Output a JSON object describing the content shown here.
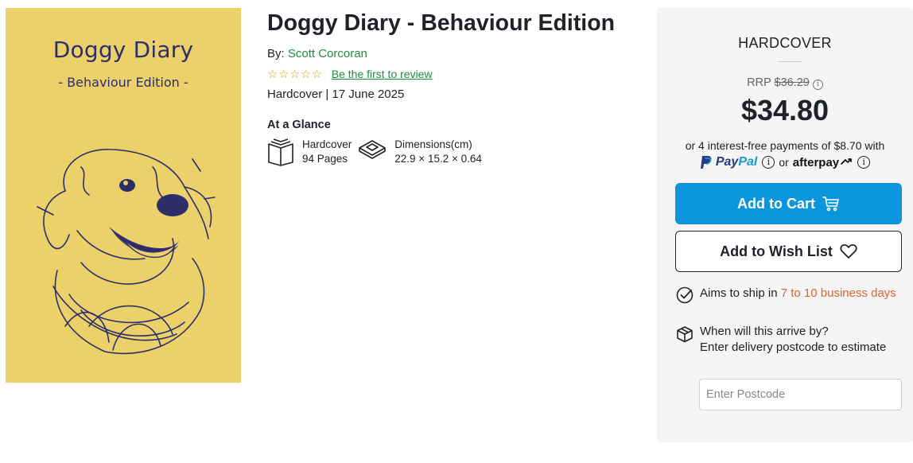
{
  "cover": {
    "title": "Doggy Diary",
    "subtitle": "- Behaviour Edition -"
  },
  "product": {
    "title": "Doggy Diary - Behaviour Edition",
    "by_label": "By:",
    "author": "Scott Corcoran",
    "stars": "☆☆☆☆☆",
    "review_link": "Be the first to review",
    "format_date": "Hardcover | 17 June 2025"
  },
  "glance": {
    "heading": "At a Glance",
    "items": [
      {
        "line1": "Hardcover",
        "line2": "94 Pages",
        "icon": "book-icon"
      },
      {
        "line1": "Dimensions(cm)",
        "line2": "22.9 × 15.2 × 0.64",
        "icon": "dimensions-icon"
      }
    ]
  },
  "purchase": {
    "format": "HARDCOVER",
    "rrp_label": "RRP",
    "rrp_value": "$36.29",
    "rrp_info": "i",
    "price": "$34.80",
    "installments": "or 4 interest-free payments of $8.70 with",
    "paypal_a": "Pay",
    "paypal_b": "Pal",
    "or_text": "or",
    "afterpay": "afterpay",
    "info_glyph": "i",
    "add_to_cart": "Add to Cart",
    "add_to_wishlist": "Add to Wish List",
    "ship_prefix": "Aims to ship in",
    "ship_window": "7 to 10 business days",
    "arrive_question": "When will this arrive by?",
    "arrive_hint": "Enter delivery postcode to estimate",
    "postcode_placeholder": "Enter Postcode"
  },
  "colors": {
    "accent_blue": "#0a96dc",
    "link_green": "#1e8e3e",
    "ship_orange": "#e0622c",
    "cover_yellow": "#ecd06a",
    "cover_ink": "#2c2f6a"
  }
}
